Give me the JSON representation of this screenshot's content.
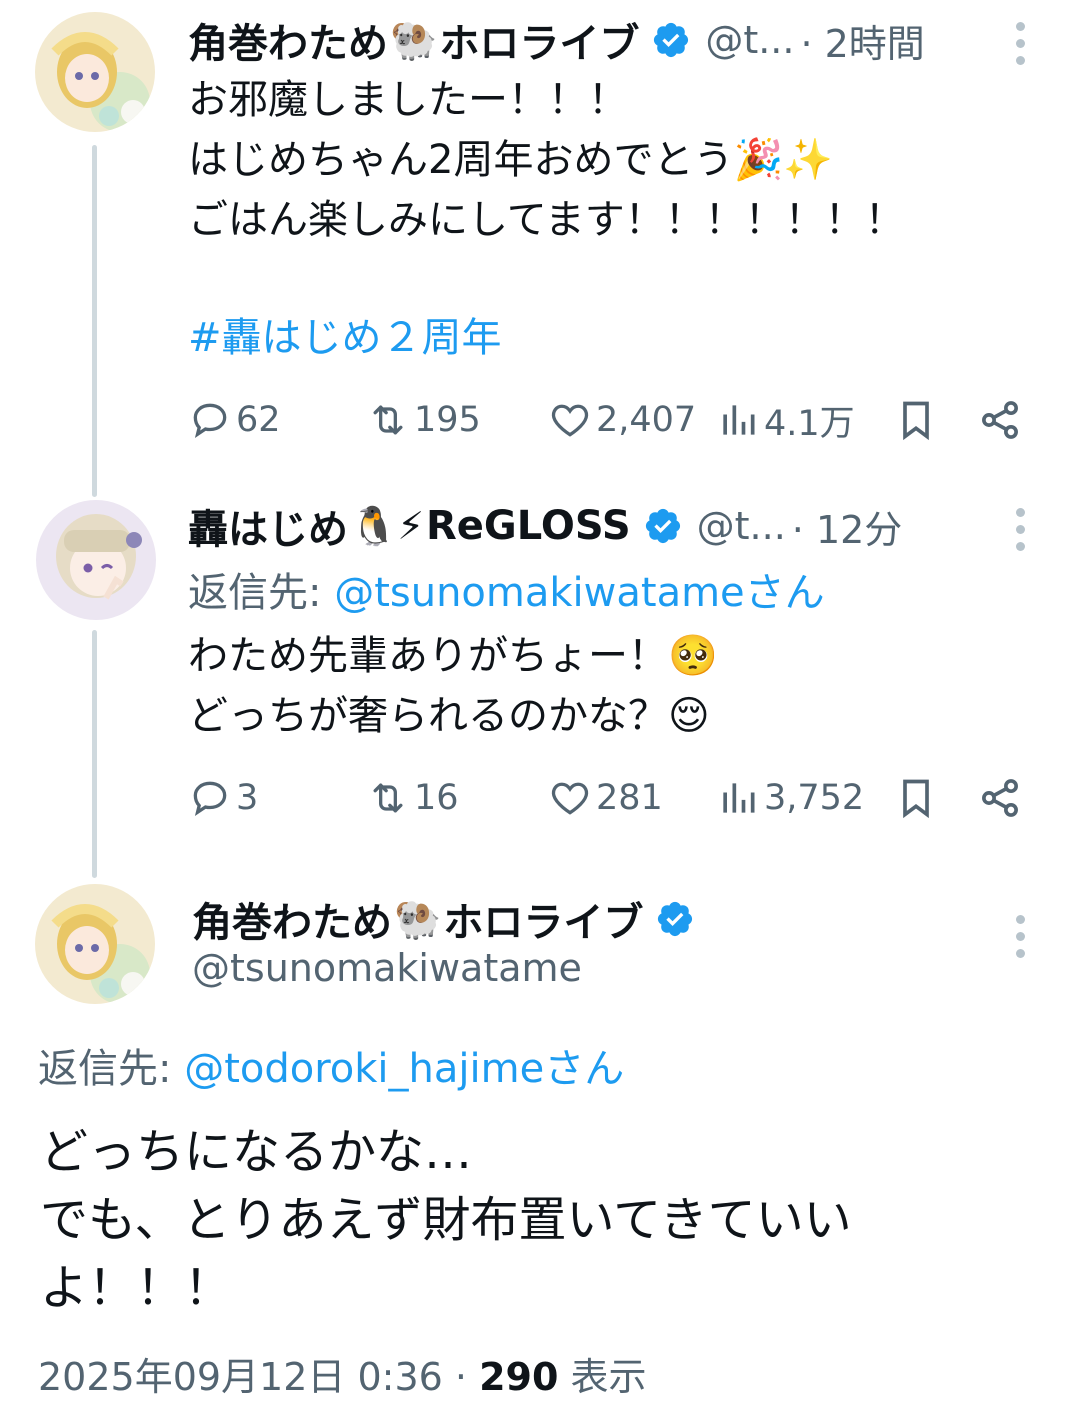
{
  "colors": {
    "accent": "#1d9bf0",
    "secondary_text": "#536471",
    "thread_line": "#cfd9de"
  },
  "tweets": [
    {
      "name": "角巻わため",
      "name_emoji": "🐏",
      "name_suffix": "ホロライブ",
      "handle_short": "@t...",
      "time": "· 2時間",
      "lines": [
        "お邪魔しましたー！！！",
        "はじめちゃん2周年おめでとう🎉✨",
        "ごはん楽しみにしてます！！！！！！！"
      ],
      "hashtag": "#轟はじめ２周年",
      "replies": "62",
      "reposts": "195",
      "likes": "2,407",
      "views": "4.1万"
    },
    {
      "name": "轟はじめ",
      "name_emoji": "🐧⚡",
      "name_suffix": "ReGLOSS",
      "handle_short": "@t...",
      "time": "· 12分",
      "reply_to_label": "返信先: ",
      "reply_to_mention": "@tsunomakiwatameさん",
      "lines": [
        "わため先輩ありがちょー！🥺",
        "どっちが奢られるのかな？😌"
      ],
      "replies": "3",
      "reposts": "16",
      "likes": "281",
      "views": "3,752"
    }
  ],
  "main": {
    "name": "角巻わため",
    "name_emoji": "🐏",
    "name_suffix": "ホロライブ",
    "handle": "@tsunomakiwatame",
    "reply_to_label": "返信先: ",
    "reply_to_mention": "@todoroki_hajimeさん",
    "lines": [
      "どっちになるかな…",
      "でも、とりあえず財布置いてきていい",
      "よ！！！"
    ],
    "date": "2025年09月12日 0:36 · ",
    "views_count": "290",
    "views_label": " 表示"
  }
}
